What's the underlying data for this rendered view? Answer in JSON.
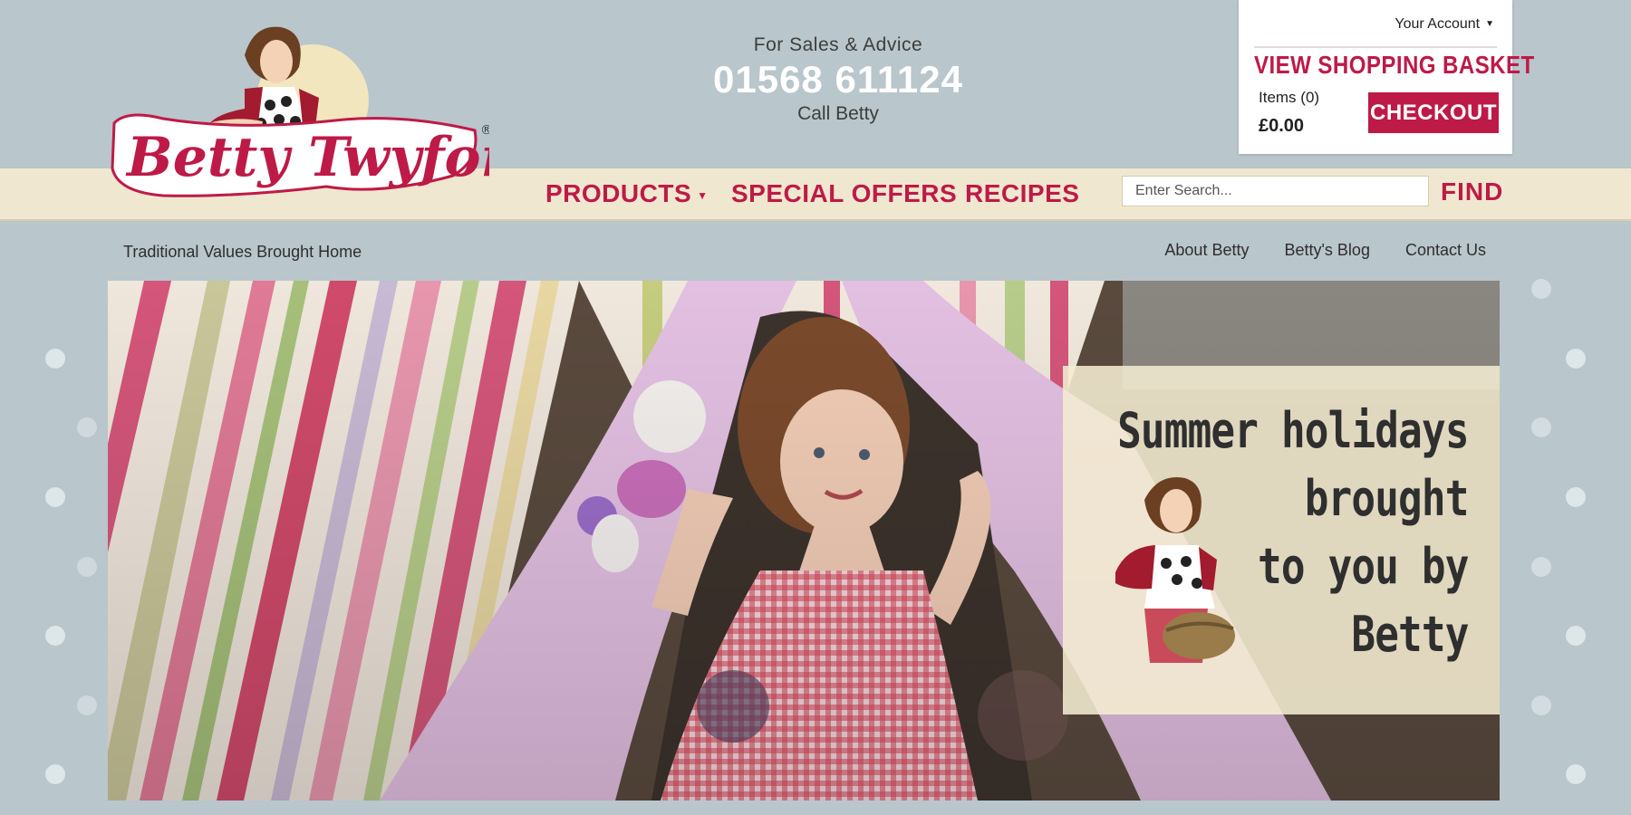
{
  "brand": {
    "name": "Betty Twyford",
    "registered": "®"
  },
  "sales": {
    "label": "For Sales & Advice",
    "phone": "01568 611124",
    "call": "Call Betty"
  },
  "basket": {
    "account_label": "Your Account",
    "view_basket": "VIEW SHOPPING BASKET",
    "items": "Items (0)",
    "total": "£0.00",
    "checkout": "CHECKOUT"
  },
  "nav": {
    "items": [
      {
        "label": "PRODUCTS",
        "has_dropdown": true
      },
      {
        "label": "SPECIAL OFFERS"
      },
      {
        "label": "RECIPES"
      }
    ],
    "search_placeholder": "Enter Search...",
    "find": "FIND"
  },
  "subnav": {
    "tagline": "Traditional Values Brought Home",
    "links": [
      "About Betty",
      "Betty's Blog",
      "Contact Us"
    ]
  },
  "hero": {
    "promo_lines": [
      "Summer holidays",
      "brought",
      "to you by",
      "Betty"
    ]
  },
  "colors": {
    "accent": "#be1a47",
    "background": "#b9c6cb",
    "navbar": "#efe7cf"
  },
  "icons": [
    "caret-down-icon",
    "polka-dot"
  ]
}
